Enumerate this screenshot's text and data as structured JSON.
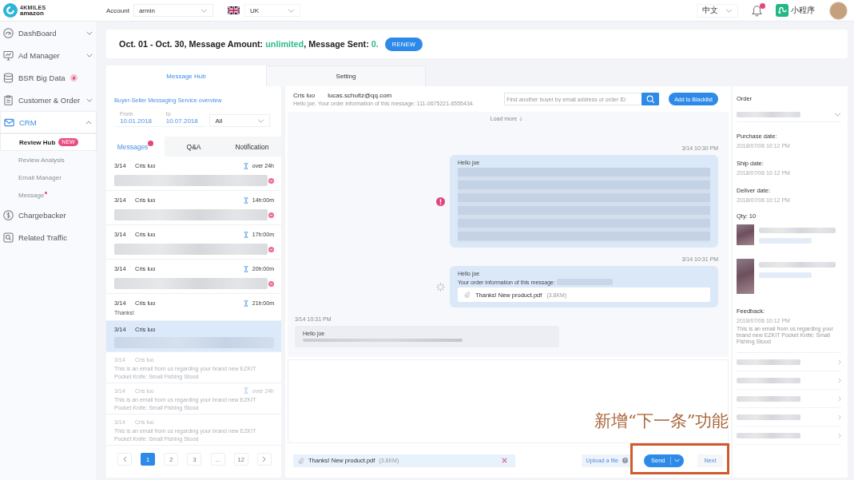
{
  "header": {
    "logo_title": "4KMILES",
    "logo_subtitle": "amazon",
    "account_label": "Account",
    "account": "armin",
    "region": "UK",
    "language": "中文",
    "notifications_unread": true,
    "mini_program": "小程序"
  },
  "sidebar": {
    "items": [
      {
        "label": "DashBoard",
        "kind": "group",
        "expanded": false,
        "selected": false,
        "hot": false
      },
      {
        "label": "Ad Manager",
        "kind": "group",
        "expanded": false,
        "selected": false,
        "hot": false
      },
      {
        "label": "BSR Big Data",
        "kind": "link",
        "selected": false,
        "hot": true
      },
      {
        "label": "Customer & Order",
        "kind": "group",
        "expanded": false,
        "selected": false,
        "hot": false
      },
      {
        "label": "CRM",
        "kind": "group",
        "expanded": true,
        "selected": true,
        "hot": false,
        "children": [
          {
            "label": "Review Hub",
            "selected": true,
            "badge": "NEW",
            "dot": false
          },
          {
            "label": "Review Analysis",
            "selected": false,
            "dot": false
          },
          {
            "label": "Email Manager",
            "selected": false,
            "dot": false
          },
          {
            "label": "Message",
            "selected": false,
            "dot": true
          }
        ]
      },
      {
        "label": "Chargebacker",
        "kind": "link",
        "selected": false,
        "hot": false
      },
      {
        "label": "Related Traffic",
        "kind": "link",
        "selected": false,
        "hot": false
      }
    ]
  },
  "usage": {
    "period_label": "Oct. 01 - Oct. 30, Message Amount:",
    "amount": "unlimited",
    "sent_label": ", Message Sent:",
    "sent": "0.",
    "renew_button": "RENEW"
  },
  "tabs": [
    {
      "label": "Message Hub",
      "selected": true
    },
    {
      "label": "Setting",
      "selected": false
    }
  ],
  "message_hub": {
    "overview_link": "Buyer-Seller Messaging Service overview",
    "from_label": "From",
    "from_date": "10.01.2018",
    "to_label": "to",
    "to_date": "10.07.2018",
    "status_filter": "All",
    "tabs": [
      {
        "label": "Messages",
        "selected": true,
        "unread": true
      },
      {
        "label": "Q&A",
        "selected": false,
        "unread": false
      },
      {
        "label": "Notification",
        "selected": false,
        "unread": false
      }
    ],
    "conversations": [
      {
        "date": "3/14",
        "name": "Cris luo",
        "wait": "over 24h",
        "preview_blurred": true,
        "unread": true,
        "selected": false,
        "dimmed": false
      },
      {
        "date": "3/14",
        "name": "Cris luo",
        "wait": "14h:00m",
        "preview_blurred": true,
        "unread": true,
        "selected": false,
        "dimmed": false
      },
      {
        "date": "3/14",
        "name": "Cris luo",
        "wait": "17h:00m",
        "preview_blurred": true,
        "unread": true,
        "selected": false,
        "dimmed": false
      },
      {
        "date": "3/14",
        "name": "Cris luo",
        "wait": "20h:00m",
        "preview_blurred": true,
        "unread": true,
        "selected": false,
        "dimmed": false
      },
      {
        "date": "3/14",
        "name": "Cris luo",
        "wait": "21h:00m",
        "preview": "Thanks!",
        "preview_blurred": false,
        "unread": false,
        "selected": false,
        "dimmed": false
      },
      {
        "date": "3/14",
        "name": "Cris luo",
        "preview_blurred": true,
        "unread": false,
        "selected": true,
        "dimmed": false
      },
      {
        "date": "3/14",
        "name": "Cris luo",
        "preview": "This is an email from us regarding your brand new EZKIT Pocket Knife: Small Fishing Stood",
        "preview_blurred": false,
        "unread": false,
        "selected": false,
        "dimmed": true
      },
      {
        "date": "3/14",
        "name": "Cris luo",
        "wait": "over 24h",
        "preview": "This is an email from us regarding your brand new EZKIT Pocket Knife: Small Fishing Stood",
        "preview_blurred": false,
        "unread": false,
        "selected": false,
        "dimmed": true
      },
      {
        "date": "3/14",
        "name": "Cris luo",
        "preview": "This is an email from us regarding your brand new EZKIT Pocket Knife: Small Fishing Stood",
        "preview_blurred": false,
        "unread": false,
        "selected": false,
        "dimmed": true
      }
    ],
    "pages": [
      {
        "label": "1",
        "selected": true
      },
      {
        "label": "2",
        "selected": false
      },
      {
        "label": "3",
        "selected": false
      },
      {
        "label": "...",
        "selected": false
      },
      {
        "label": "12",
        "selected": false
      }
    ]
  },
  "chat": {
    "contact_name": "Cris luo",
    "contact_email": "lucas.schultz@qq.com",
    "summary": "Hello joe. Your order information of this message: 111-0675221-6555434.",
    "search_placeholder": "Find another buyer by email address or order ID",
    "blacklist_button": "Add to Blacklist",
    "load_more": "Load more",
    "messages": [
      {
        "kind": "outgoing",
        "time": "3/14 10:30 PM",
        "greeting": "Hello joe",
        "failed": true,
        "sending": false
      },
      {
        "kind": "outgoing",
        "time": "3/14 10:31 PM",
        "greeting": "Hello joe",
        "line": "Your order information of this message:",
        "attachment_name": "Thanks! New product.pdf",
        "attachment_size": "(3.8KM)",
        "failed": false,
        "sending": true
      },
      {
        "kind": "incoming",
        "time": "3/14 10:31 PM",
        "greeting": "Hello joe",
        "failed": false,
        "sending": false
      }
    ]
  },
  "compose": {
    "attachment_name": "Thanks! New product.pdf",
    "attachment_size": "(3.8KM)",
    "upload_button": "Upload a file",
    "send_button": "Send",
    "next_button": "Next"
  },
  "order_panel": {
    "title": "Order",
    "dates": [
      {
        "label": "Purchase date:",
        "value": "2018/07/06 10:12 PM"
      },
      {
        "label": "Ship date:",
        "value": "2018/07/06 10:12 PM"
      },
      {
        "label": "Deliver date:",
        "value": "2018/07/06 10:12 PM"
      }
    ],
    "quantity": "Qty: 10",
    "products": [
      {
        "kind": "short"
      },
      {
        "kind": "tall"
      }
    ],
    "feedback_label": "Feedback:",
    "feedback_date": "2018/07/06 10:12 PM",
    "feedback_text": "This is an email from us regarding your brand new EZKIT Pocket Knife: Small Fishing Stood",
    "links": [
      {
        "kind": "blurred"
      },
      {
        "kind": "blurred"
      },
      {
        "kind": "blurred"
      },
      {
        "kind": "blurred"
      },
      {
        "kind": "blurred"
      }
    ]
  },
  "annotation": {
    "text": "新增“下一条”功能",
    "highlight": true
  }
}
